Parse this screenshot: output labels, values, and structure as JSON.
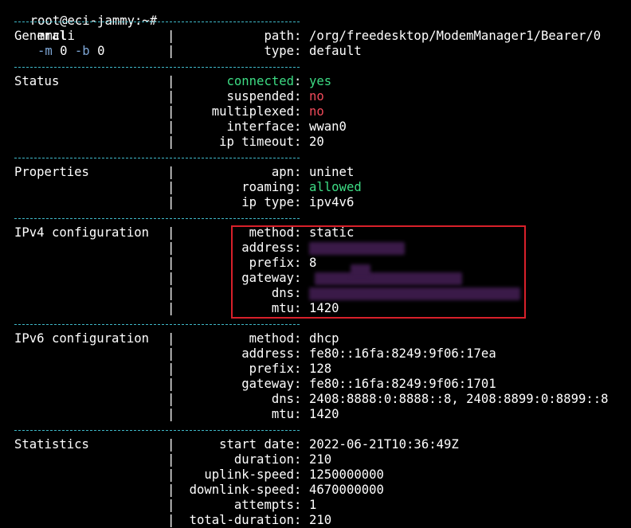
{
  "terminal": {
    "prompt": "root@eci-jammy:~#",
    "command": "mmcli",
    "args": [
      {
        "text": "-m",
        "type": "flag"
      },
      {
        "text": "0",
        "type": "plain"
      },
      {
        "text": "-b",
        "type": "flag"
      },
      {
        "text": "0",
        "type": "plain"
      }
    ]
  },
  "sections": [
    {
      "id": "general",
      "label": "General",
      "rows": [
        {
          "key": "path",
          "value": "/org/freedesktop/ModemManager1/Bearer/0"
        },
        {
          "key": "type",
          "value": "default"
        }
      ]
    },
    {
      "id": "status",
      "label": "Status",
      "rows": [
        {
          "key": "connected",
          "value": "yes",
          "color": "green",
          "key_color": "green"
        },
        {
          "key": "suspended",
          "value": "no",
          "color": "red"
        },
        {
          "key": "multiplexed",
          "value": "no",
          "color": "red"
        },
        {
          "key": "interface",
          "value": "wwan0"
        },
        {
          "key": "ip timeout",
          "value": "20"
        }
      ]
    },
    {
      "id": "properties",
      "label": "Properties",
      "rows": [
        {
          "key": "apn",
          "value": "uninet"
        },
        {
          "key": "roaming",
          "value": "allowed",
          "color": "green"
        },
        {
          "key": "ip type",
          "value": "ipv4v6"
        }
      ]
    },
    {
      "id": "ipv4",
      "label": "IPv4 configuration",
      "rows": [
        {
          "key": "method",
          "value": "static"
        },
        {
          "key": "address",
          "value": ""
        },
        {
          "key": "prefix",
          "value": "8"
        },
        {
          "key": "gateway",
          "value": ""
        },
        {
          "key": "dns",
          "value": ""
        },
        {
          "key": "mtu",
          "value": "1420"
        }
      ]
    },
    {
      "id": "ipv6",
      "label": "IPv6 configuration",
      "rows": [
        {
          "key": "method",
          "value": "dhcp"
        },
        {
          "key": "address",
          "value": "fe80::16fa:8249:9f06:17ea"
        },
        {
          "key": "prefix",
          "value": "128"
        },
        {
          "key": "gateway",
          "value": "fe80::16fa:8249:9f06:1701"
        },
        {
          "key": "dns",
          "value": "2408:8888:0:8888::8, 2408:8899:0:8899::8"
        },
        {
          "key": "mtu",
          "value": "1420"
        }
      ]
    },
    {
      "id": "statistics",
      "label": "Statistics",
      "rows": [
        {
          "key": "start date",
          "value": "2022-06-21T10:36:49Z"
        },
        {
          "key": "duration",
          "value": "210"
        },
        {
          "key": "uplink-speed",
          "value": "1250000000"
        },
        {
          "key": "downlink-speed",
          "value": "4670000000"
        },
        {
          "key": "attempts",
          "value": "1"
        },
        {
          "key": "total-duration",
          "value": "210"
        }
      ]
    }
  ],
  "colors": {
    "background": "#000000",
    "text": "#ffffff",
    "separator": "#3fb8c8",
    "green": "#3ddc84",
    "red": "#f04a5a",
    "flag": "#7fa8d8",
    "highlight": "#d8202a"
  },
  "redacted_fields": [
    "ipv4.address",
    "ipv4.gateway",
    "ipv4.dns"
  ],
  "highlighted_section": "ipv4"
}
